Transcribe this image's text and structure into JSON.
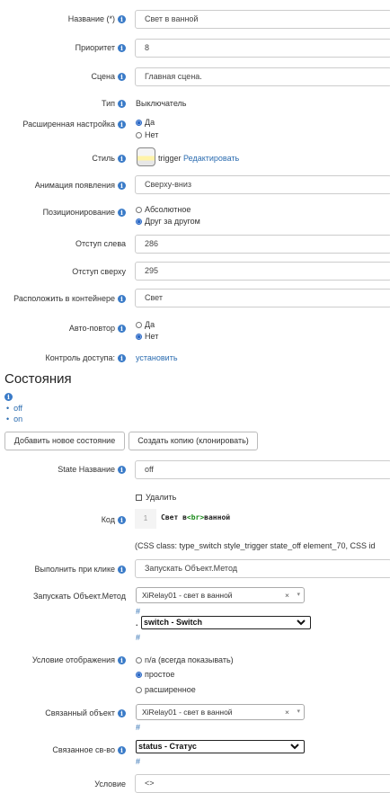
{
  "form": {
    "name": {
      "label": "Название (*)",
      "value": "Свет в ванной"
    },
    "priority": {
      "label": "Приоритет",
      "value": "8"
    },
    "scene": {
      "label": "Сцена",
      "value": "Главная сцена."
    },
    "type": {
      "label": "Тип",
      "value": "Выключатель"
    },
    "advanced": {
      "label": "Расширенная настройка",
      "options": [
        "Да",
        "Нет"
      ],
      "selected": "Да"
    },
    "style": {
      "label": "Стиль",
      "value": "trigger",
      "edit_link": "Редактировать"
    },
    "animation": {
      "label": "Анимация появления",
      "value": "Сверху-вниз"
    },
    "positioning": {
      "label": "Позиционирование",
      "options": [
        "Абсолютное",
        "Друг за другом"
      ],
      "selected": "Друг за другом"
    },
    "offset_left": {
      "label": "Отступ слева",
      "value": "286"
    },
    "offset_top": {
      "label": "Отступ сверху",
      "value": "295"
    },
    "container": {
      "label": "Расположить в контейнере",
      "value": "Свет"
    },
    "autorepeat": {
      "label": "Авто-повтор",
      "options": [
        "Да",
        "Нет"
      ],
      "selected": "Нет"
    },
    "access": {
      "label": "Контроль доступа:",
      "link": "установить"
    }
  },
  "states": {
    "heading": "Состояния",
    "items": [
      "off",
      "on"
    ],
    "add_button": "Добавить новое состояние",
    "clone_button": "Создать копию (клонировать)"
  },
  "state_form": {
    "name": {
      "label": "State Название",
      "value": "off"
    },
    "delete": {
      "label": "Удалить",
      "checked": false
    },
    "code": {
      "label": "Код",
      "line_number": "1",
      "code_before": "Свет в",
      "code_tag": "<br>",
      "code_after": "ванной"
    },
    "css_info": "(CSS class: type_switch style_trigger state_off element_70, CSS id",
    "on_click": {
      "label": "Выполнить при клике",
      "value": "Запускать Объект.Метод"
    },
    "run_method": {
      "label": "Запускать Объект.Метод",
      "object_value": "XiRelay01 - свет в ванной",
      "hash": "#",
      "method_prefix": ".",
      "method_value": "switch - Switch",
      "hash2": "#"
    },
    "display_condition": {
      "label": "Условие отображения",
      "options": [
        "n/a (всегда показывать)",
        "простое",
        "расширенное"
      ],
      "selected": "простое"
    },
    "linked_object": {
      "label": "Связанный объект",
      "value": "XiRelay01 - свет в ванной",
      "hash": "#"
    },
    "linked_property": {
      "label": "Связанное св-во",
      "value": "status - Статус",
      "hash": "#"
    },
    "condition": {
      "label": "Условие",
      "value": "<>"
    }
  },
  "colors": {
    "accent": "#2b6cb0",
    "info_icon": "#3a7bc8",
    "border": "#cccccc"
  }
}
